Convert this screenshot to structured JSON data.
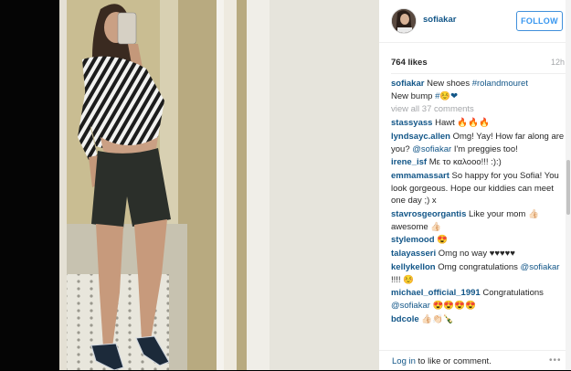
{
  "post": {
    "owner": "sofiakar",
    "follow_label": "FOLLOW",
    "likes": "764 likes",
    "time": "12h",
    "caption_user": "sofiakar",
    "caption_line1": "New shoes",
    "caption_tag": "#rolandmouret",
    "caption_line2": "New bump",
    "caption_tag2": "#☺️❤",
    "view_all": "view all 37 comments"
  },
  "comments": [
    {
      "user": "stassyass",
      "text": "Hawt 🔥🔥🔥"
    },
    {
      "user": "lyndsayc.allen",
      "text": "Omg! Yay! How far along are you?",
      "mention": "@sofiakar",
      "text2": "I'm preggies too!"
    },
    {
      "user": "irene_isf",
      "text": "Με το καλοοο!!! :):)"
    },
    {
      "user": "emmamassart",
      "text": "So happy for you Sofia! You look gorgeous. Hope our kiddies can meet one day ;) x"
    },
    {
      "user": "stavrosgeorgantis",
      "text": "Like your mom 👍🏻 awesome 👍🏻"
    },
    {
      "user": "stylemood",
      "text": "😍"
    },
    {
      "user": "talayasseri",
      "text": "Omg no way ♥♥♥♥♥"
    },
    {
      "user": "kellykellon",
      "text": "Omg congratulations",
      "mention": "@sofiakar",
      "text2": "!!!! ☺️"
    },
    {
      "user": "michael_official_1991",
      "text": "Congratulations",
      "mention": "@sofiakar",
      "text2": "😍😍😍😍"
    },
    {
      "user": "bdcole",
      "text": "👍🏻👏🏻🍾"
    }
  ],
  "footer": {
    "login_link": "Log in",
    "login_rest": " to like or comment.",
    "more": "•••"
  },
  "colors": {
    "link": "#125688",
    "follow": "#3897f0"
  }
}
